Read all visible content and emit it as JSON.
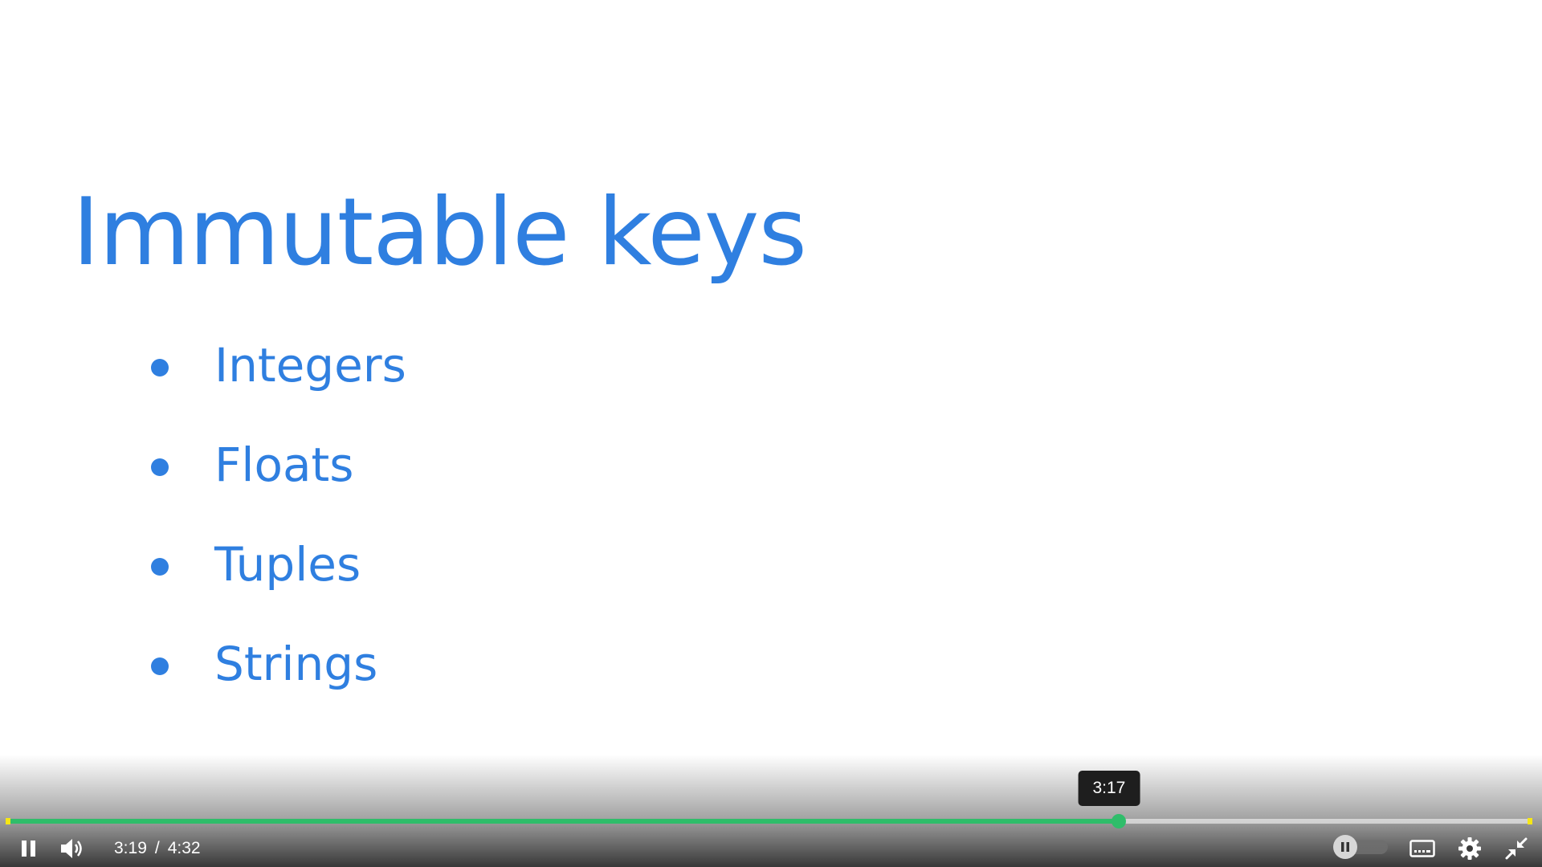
{
  "slide": {
    "title": "Immutable keys",
    "bullets": [
      "Integers",
      "Floats",
      "Tuples",
      "Strings"
    ],
    "text_color": "#2f7fe0"
  },
  "player": {
    "current_time": "3:19",
    "separator": "/",
    "duration": "4:32",
    "hover_time": "3:17",
    "progress_fraction": 0.729,
    "accent_color": "#2fbd6a",
    "marker_color": "#f6e714",
    "buttons": {
      "pause": "pause-icon",
      "volume": "volume-icon",
      "autoplay_toggle": "pause-icon",
      "captions": "captions-icon",
      "settings": "gear-icon",
      "exit_fullscreen": "exit-fullscreen-icon"
    }
  }
}
